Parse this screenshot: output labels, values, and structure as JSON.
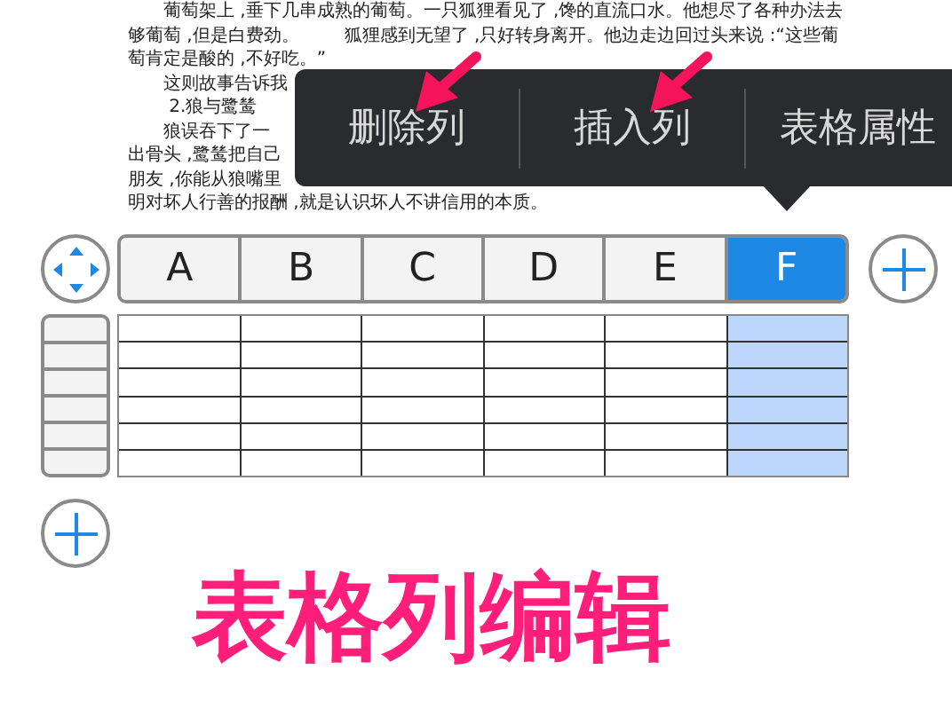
{
  "document": {
    "lines": [
      {
        "text": "　　葡萄架上 ,垂下几串成熟的葡萄。一只狐狸看见了 ,馋的直流口水。他想尽了各种办法去"
      },
      {
        "text": "够葡萄 ,但是白费劲。        狐狸感到无望了 ,只好转身离开。他边走边回过头来说 :“这些葡"
      },
      {
        "text": "萄肯定是酸的 ,不好吃。”"
      },
      {
        "text": "　　这则故事告诉我"
      },
      {
        "text": "　　 2.狼与鹭鸶"
      },
      {
        "text": "　　狼误吞下了一"
      },
      {
        "text": "出骨头 ,鹭鸶把自己"
      },
      {
        "text": "朋友 ,你能从狼嘴里"
      },
      {
        "text": "明对坏人行善的报酬 ,就是认识坏人不讲信用的本质。"
      }
    ]
  },
  "context_menu": {
    "items": [
      {
        "label": "删除列"
      },
      {
        "label": "插入列"
      },
      {
        "label": "表格属性"
      }
    ]
  },
  "table": {
    "columns": [
      {
        "label": "A",
        "selected": false
      },
      {
        "label": "B",
        "selected": false
      },
      {
        "label": "C",
        "selected": false
      },
      {
        "label": "D",
        "selected": false
      },
      {
        "label": "E",
        "selected": false
      },
      {
        "label": "F",
        "selected": true
      }
    ]
  },
  "caption": "表格列编辑"
}
